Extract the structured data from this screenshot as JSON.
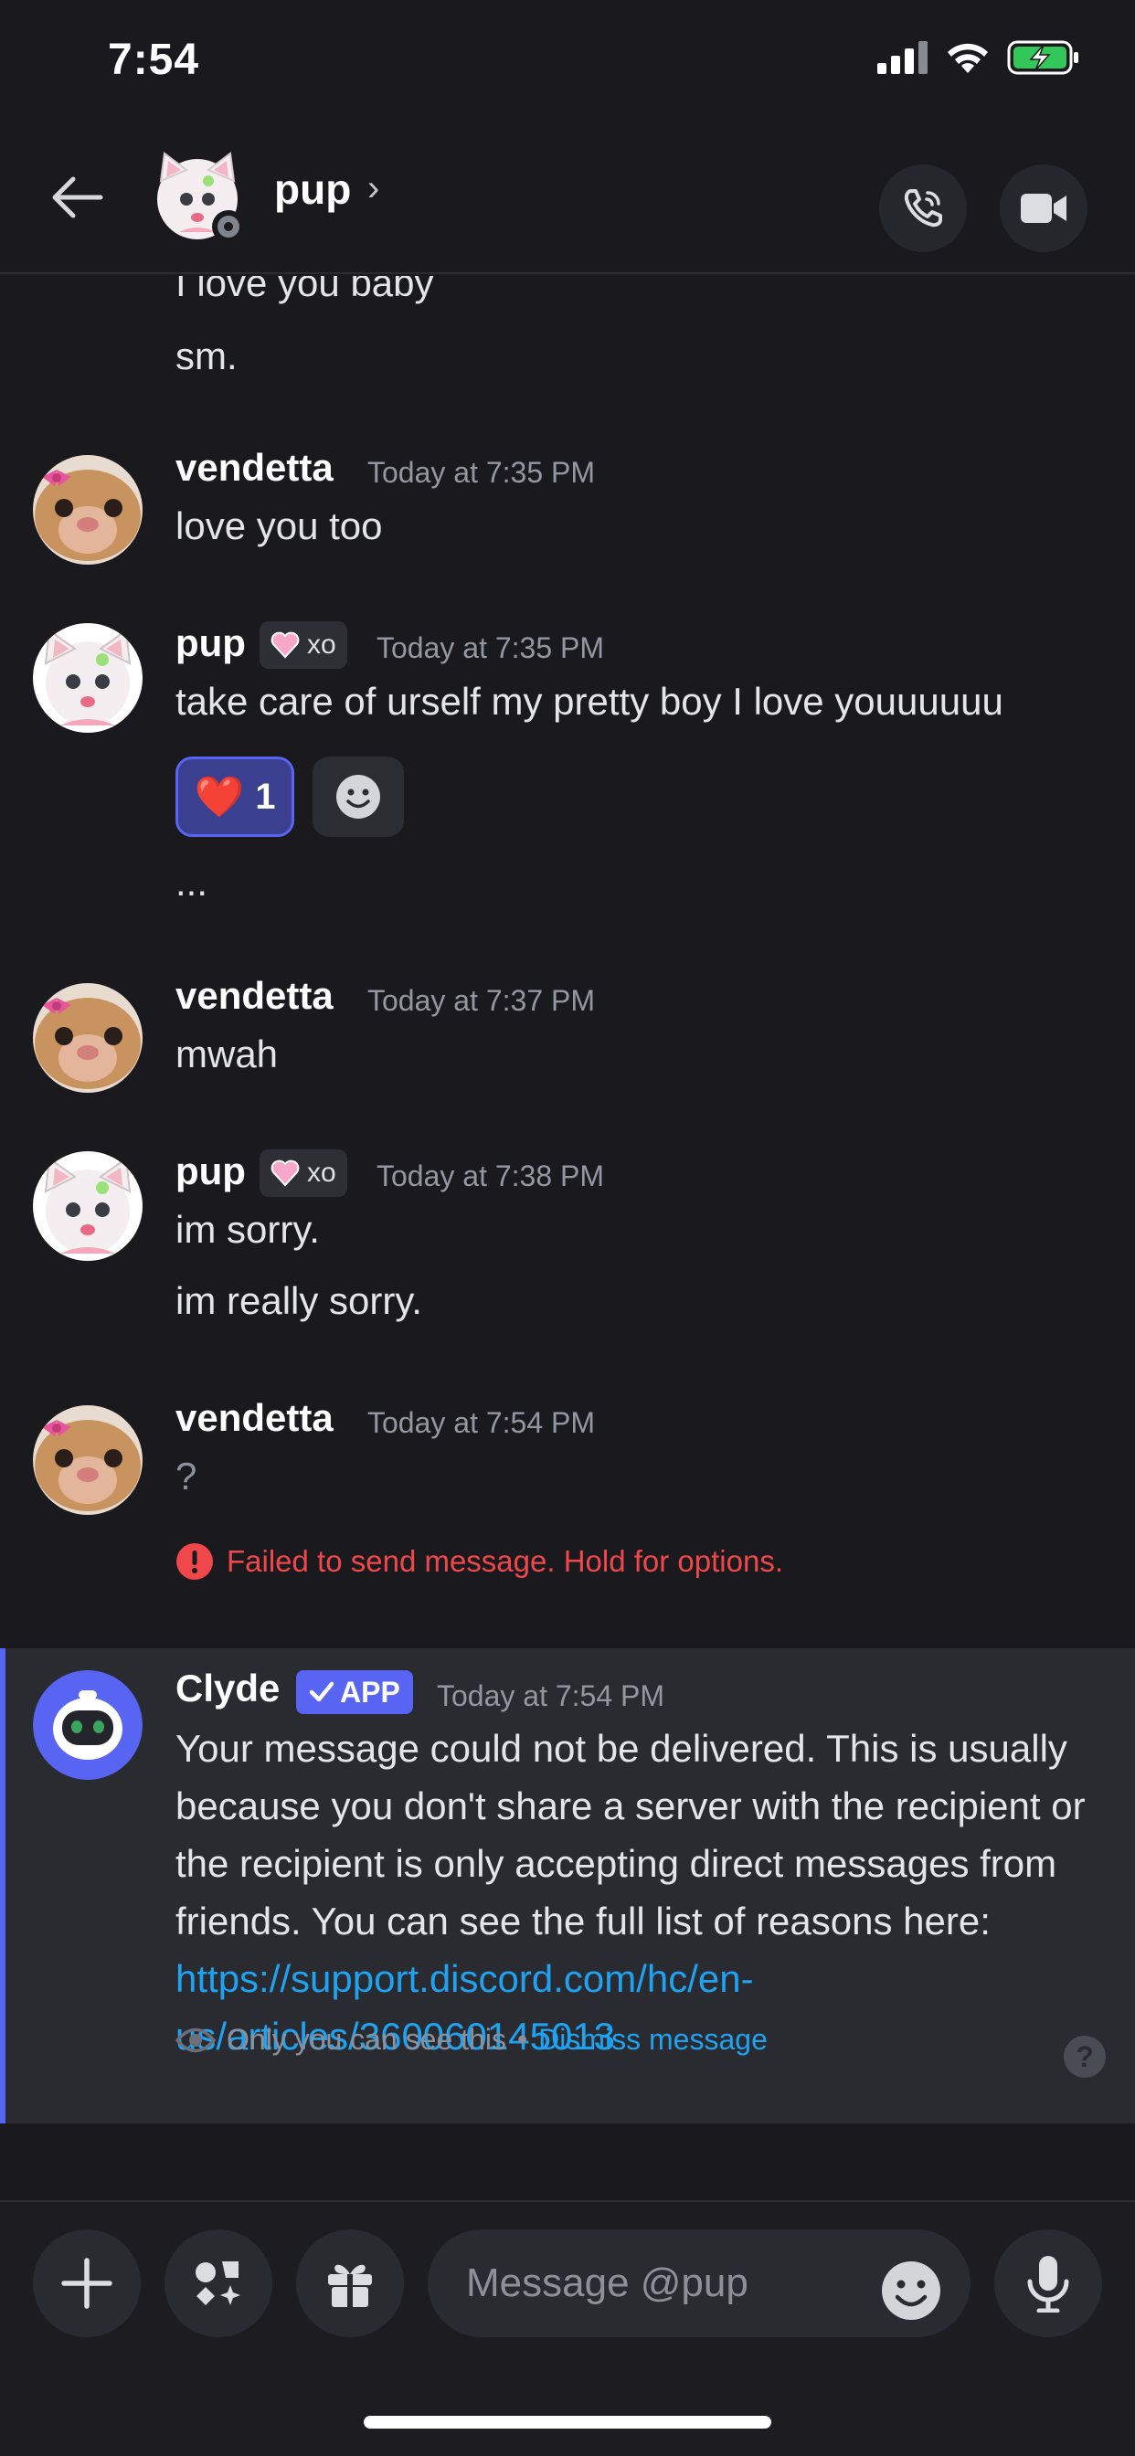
{
  "status_bar": {
    "time": "7:54"
  },
  "header": {
    "name": "pup",
    "chevron": "›"
  },
  "messages": {
    "partial_1": "I love you baby",
    "partial_2": "sm.",
    "m1": {
      "author": "vendetta",
      "timestamp": "Today at 7:35 PM",
      "text": "love you too"
    },
    "m2": {
      "author": "pup",
      "tag": "xo",
      "timestamp": "Today at 7:35 PM",
      "text": "take care of urself my pretty boy I love youuuuuu",
      "reaction": {
        "emoji": "❤️",
        "count": "1"
      },
      "ellipsis": "..."
    },
    "m3": {
      "author": "vendetta",
      "timestamp": "Today at 7:37 PM",
      "text": "mwah"
    },
    "m4": {
      "author": "pup",
      "tag": "xo",
      "timestamp": "Today at 7:38 PM",
      "text_1": "im sorry.",
      "text_2": "im really sorry."
    },
    "m5": {
      "author": "vendetta",
      "timestamp": "Today at 7:54 PM",
      "text": "?",
      "error": "Failed to send message. Hold for options."
    },
    "clyde": {
      "author": "Clyde",
      "badge": "APP",
      "timestamp": "Today at 7:54 PM",
      "body": "Your message could not be delivered. This is usually because you don't share a server with the recipient or the recipient is only accepting direct messages from friends. You can see the full list of reasons here: ",
      "link": "https://support.discord.com/hc/en-us/articles/360060145013",
      "ephemeral_note": "Only you can see this",
      "separator": "•",
      "dismiss": "Dismiss message",
      "help": "?"
    }
  },
  "composer": {
    "placeholder": "Message @pup"
  },
  "colors": {
    "accent": "#5865f2",
    "error": "#f0474b",
    "link": "#1fa2f0",
    "background": "#1a1a1e"
  },
  "icons": {
    "back": "back-arrow-icon",
    "call": "phone-call-icon",
    "video": "video-camera-icon",
    "add": "plus-icon",
    "apps": "apps-icon",
    "gift": "gift-icon",
    "emoji": "emoji-icon",
    "mic": "microphone-icon"
  }
}
